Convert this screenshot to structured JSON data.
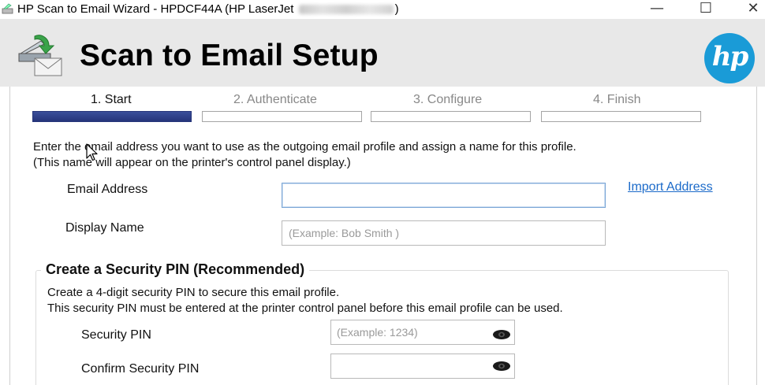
{
  "window": {
    "title_prefix": "HP Scan to Email Wizard - HPDCF44A (HP LaserJet",
    "title_suffix": ")",
    "minimize_glyph": "—",
    "maximize_glyph": "☐",
    "close_glyph": "✕"
  },
  "header": {
    "title": "Scan to Email Setup",
    "logo_text": "hp",
    "header_bg": "#e8e8e8",
    "logo_color": "#1a9bd7"
  },
  "steps": [
    {
      "label": "1. Start",
      "active": true
    },
    {
      "label": "2. Authenticate",
      "active": false
    },
    {
      "label": "3. Configure",
      "active": false
    },
    {
      "label": "4. Finish",
      "active": false
    }
  ],
  "intro": {
    "line1": "Enter the email address you want to use as the outgoing email profile and assign a name for this profile.",
    "line2": "(This name will appear on the printer's control panel display.)"
  },
  "form": {
    "email_label": "Email Address",
    "email_value": "",
    "import_link": "Import Address",
    "display_name_label": "Display Name",
    "display_name_placeholder": "(Example: Bob Smith )"
  },
  "security": {
    "title": "Create a Security PIN (Recommended)",
    "line1": "Create a 4-digit security PIN to secure this email profile.",
    "line2": "This security PIN must be entered at the printer control panel before this email profile can be used.",
    "pin_label": "Security PIN",
    "pin_placeholder": "(Example: 1234)",
    "confirm_label": "Confirm Security PIN",
    "confirm_placeholder": ""
  },
  "colors": {
    "progress_active": "#2e3f86",
    "link": "#1b6ac9"
  }
}
